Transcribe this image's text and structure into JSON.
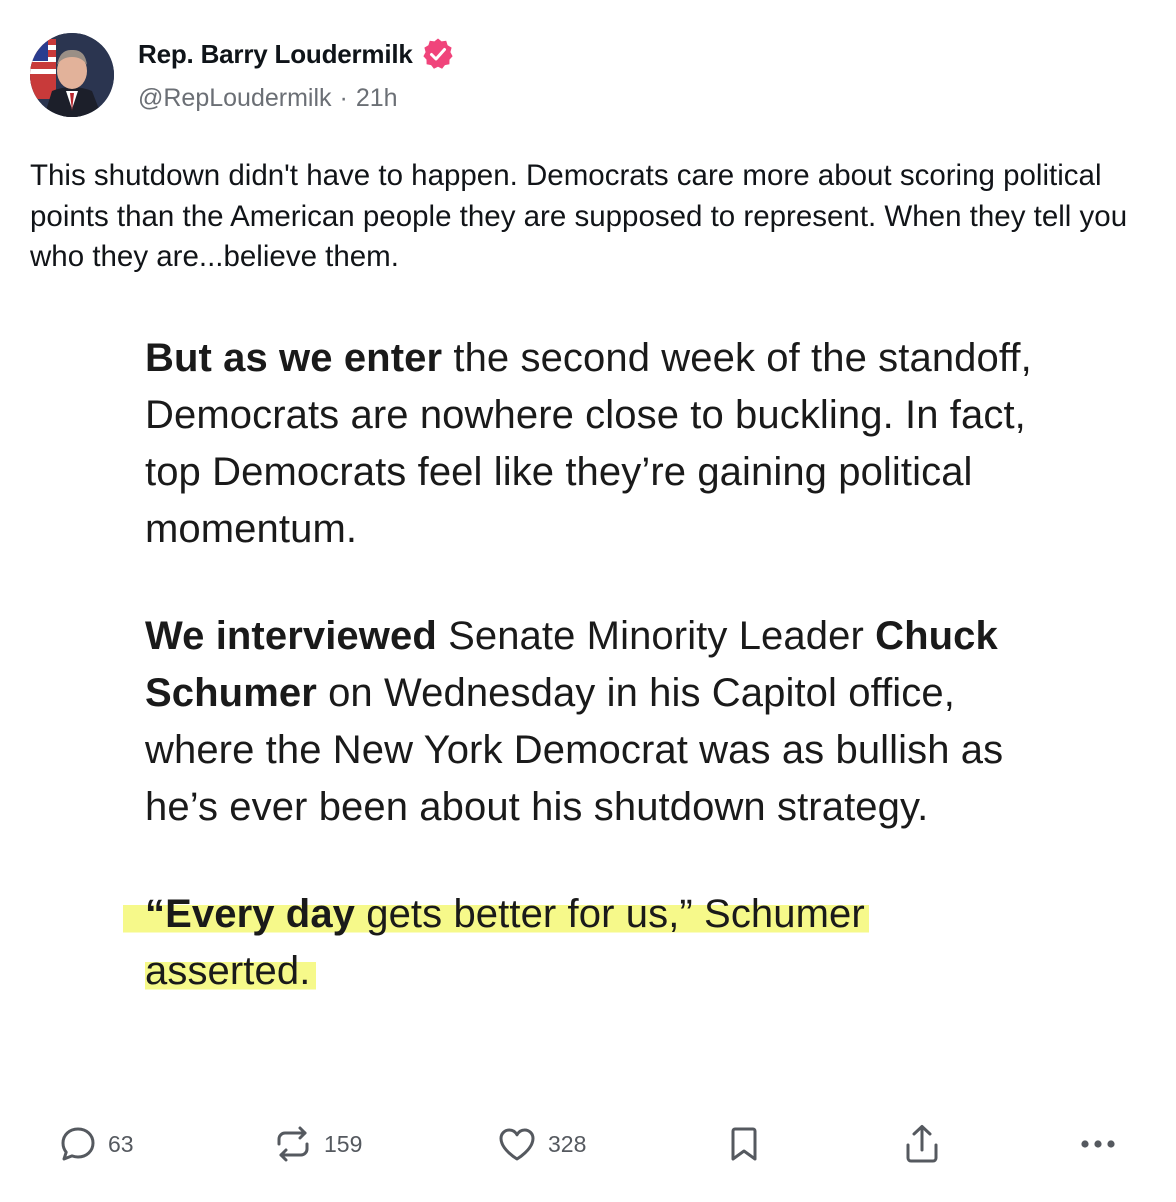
{
  "author": {
    "display_name": "Rep. Barry Loudermilk",
    "handle": "@RepLoudermilk",
    "separator": "·",
    "time_ago": "21h"
  },
  "post": {
    "text": "This shutdown didn't have to happen. Democrats care more about scoring political points than the American people they are supposed to represent. When they tell you who they are...believe them."
  },
  "article_image": {
    "p1_bold": "But as we enter",
    "p1_rest": " the second week of the standoff, Democrats are nowhere close to buckling. In fact, top Democrats feel like they’re gaining political momentum.",
    "p2_bold1": "We interviewed",
    "p2_mid": " Senate Minority Leader ",
    "p2_bold2": "Chuck Schumer",
    "p2_rest": " on Wednesday in his Capitol office, where the New York Democrat was as bullish as he’s ever been about his shutdown strategy.",
    "p3_bold": "“Every day",
    "p3_mid": " gets better for us,” Schumer",
    "p3_rest": "asserted.",
    "highlight_color": "#f6f98a"
  },
  "actions": {
    "replies": "63",
    "reposts": "159",
    "likes": "328"
  },
  "colors": {
    "verified_badge": "#f0447b",
    "secondary_text": "#6b6f75",
    "icon": "#55595f"
  }
}
